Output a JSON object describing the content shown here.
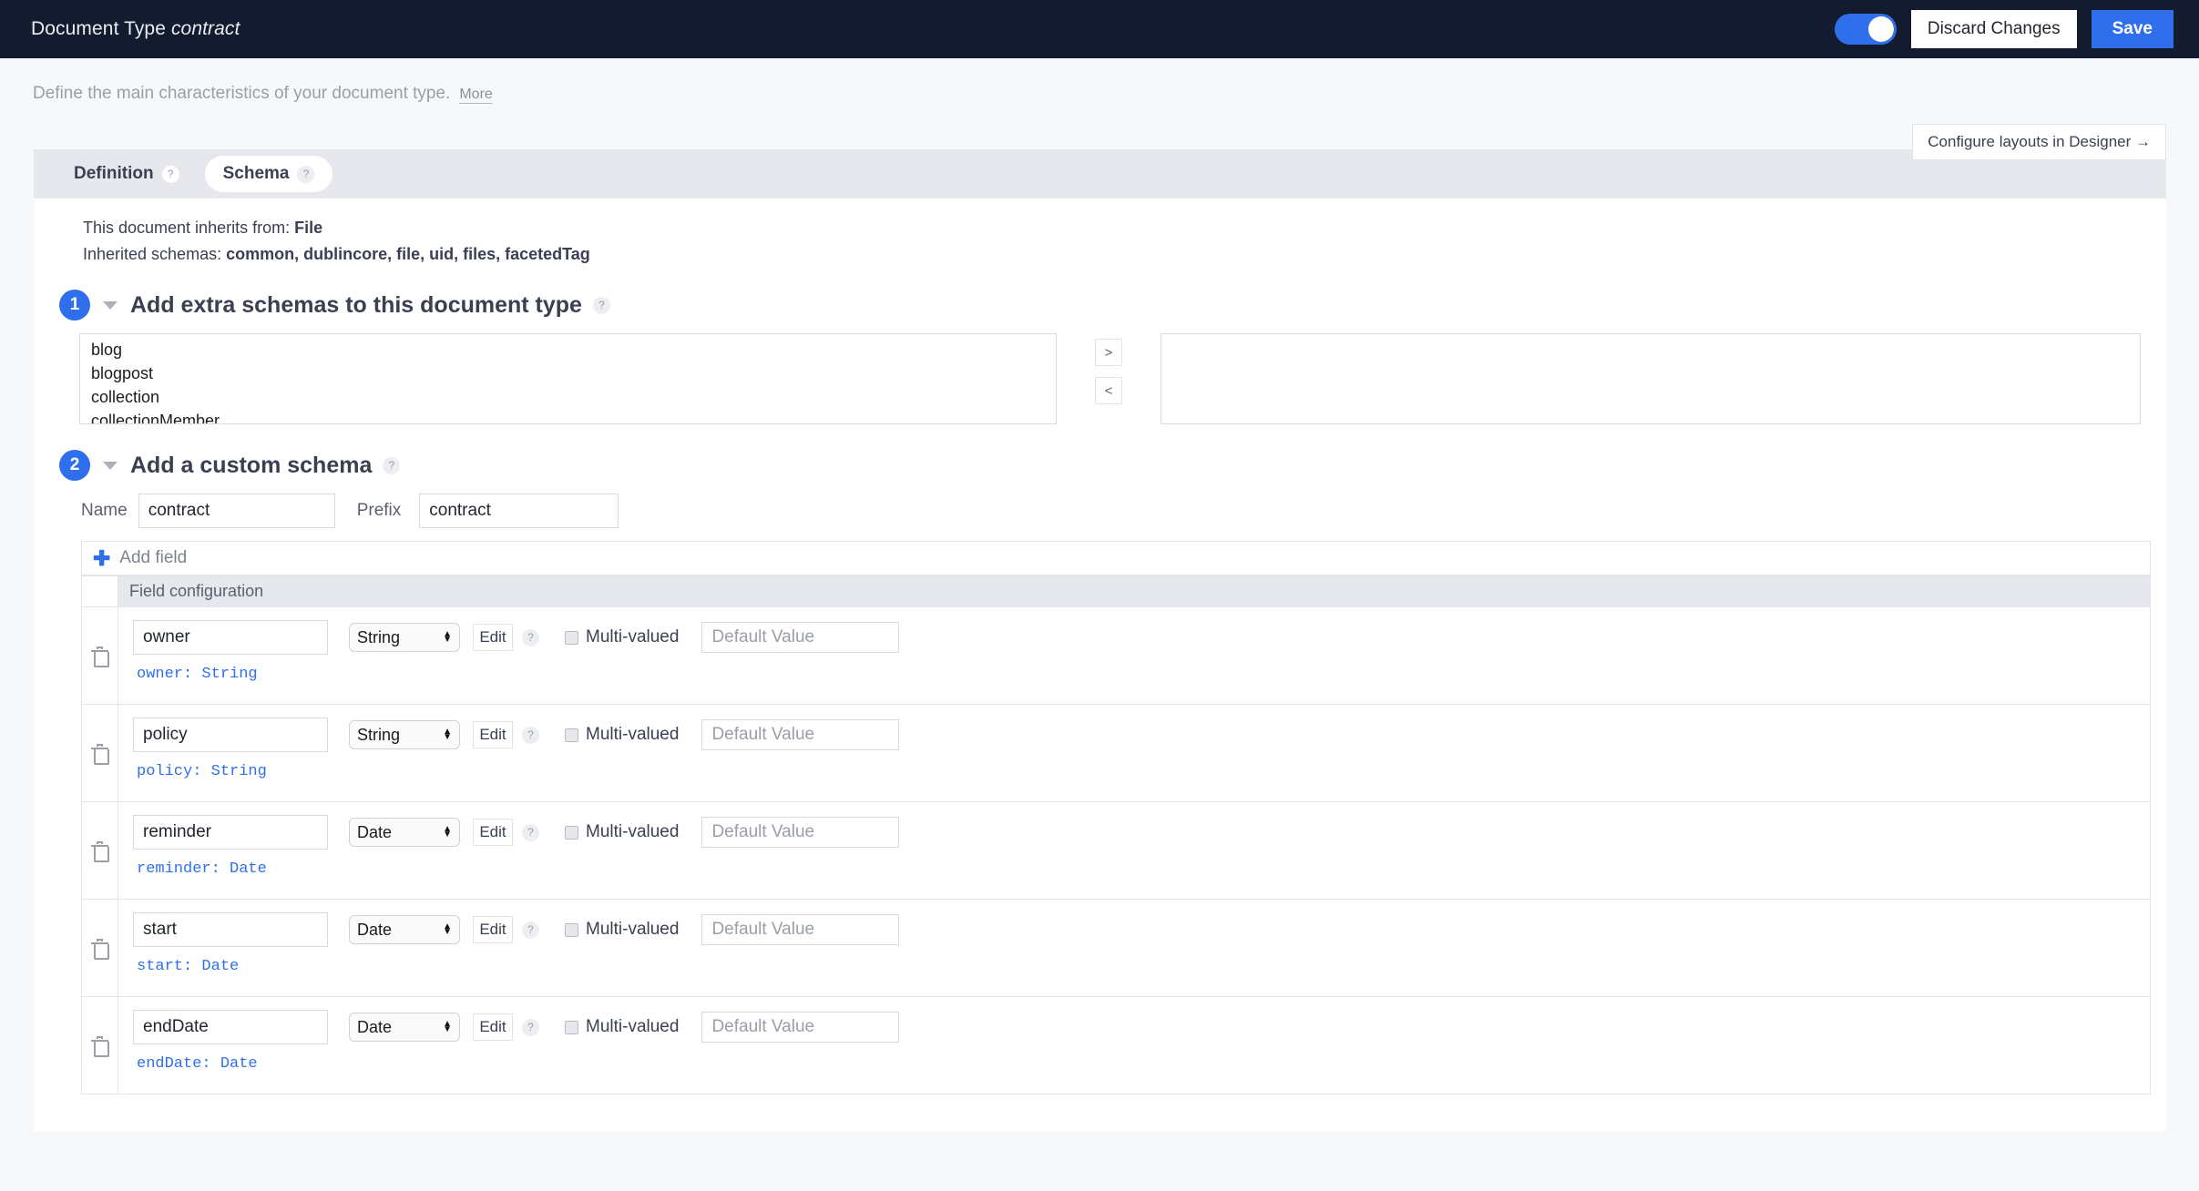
{
  "topbar": {
    "title_prefix": "Document Type ",
    "title_name": "contract",
    "discard_label": "Discard Changes",
    "save_label": "Save",
    "toggle_on": true,
    "accent": "#2f6fec",
    "background": "#131c2e"
  },
  "subheader": {
    "description": "Define the main characteristics of your document type.",
    "more_label": "More",
    "designer_button": "Configure layouts in Designer →"
  },
  "tabs": [
    {
      "label": "Definition",
      "help": "?",
      "active": false
    },
    {
      "label": "Schema",
      "help": "?",
      "active": true
    }
  ],
  "inheritance": {
    "inherits_label": "This document inherits from: ",
    "inherits_value": "File",
    "schemas_label": "Inherited schemas: ",
    "schemas_value": "common, dublincore, file, uid, files, facetedTag"
  },
  "step1": {
    "number": "1",
    "title": "Add extra schemas to this document type",
    "help": "?",
    "available": [
      "blog",
      "blogpost",
      "collection",
      "collectionMember"
    ],
    "selected": [],
    "add_button": ">",
    "remove_button": "<"
  },
  "step2": {
    "number": "2",
    "title": "Add a custom schema",
    "help": "?",
    "name_label": "Name",
    "name_value": "contract",
    "prefix_label": "Prefix",
    "prefix_value": "contract",
    "add_field_label": "Add field",
    "table_header": "Field configuration",
    "common": {
      "edit_label": "Edit",
      "help": "?",
      "multi_label": "Multi-valued",
      "default_placeholder": "Default Value"
    },
    "fields": [
      {
        "name": "owner",
        "type": "String",
        "multivalued": false,
        "default": "",
        "summary": "owner: String"
      },
      {
        "name": "policy",
        "type": "String",
        "multivalued": false,
        "default": "",
        "summary": "policy: String"
      },
      {
        "name": "reminder",
        "type": "Date",
        "multivalued": false,
        "default": "",
        "summary": "reminder: Date"
      },
      {
        "name": "start",
        "type": "Date",
        "multivalued": false,
        "default": "",
        "summary": "start: Date"
      },
      {
        "name": "endDate",
        "type": "Date",
        "multivalued": false,
        "default": "",
        "summary": "endDate: Date"
      }
    ]
  }
}
